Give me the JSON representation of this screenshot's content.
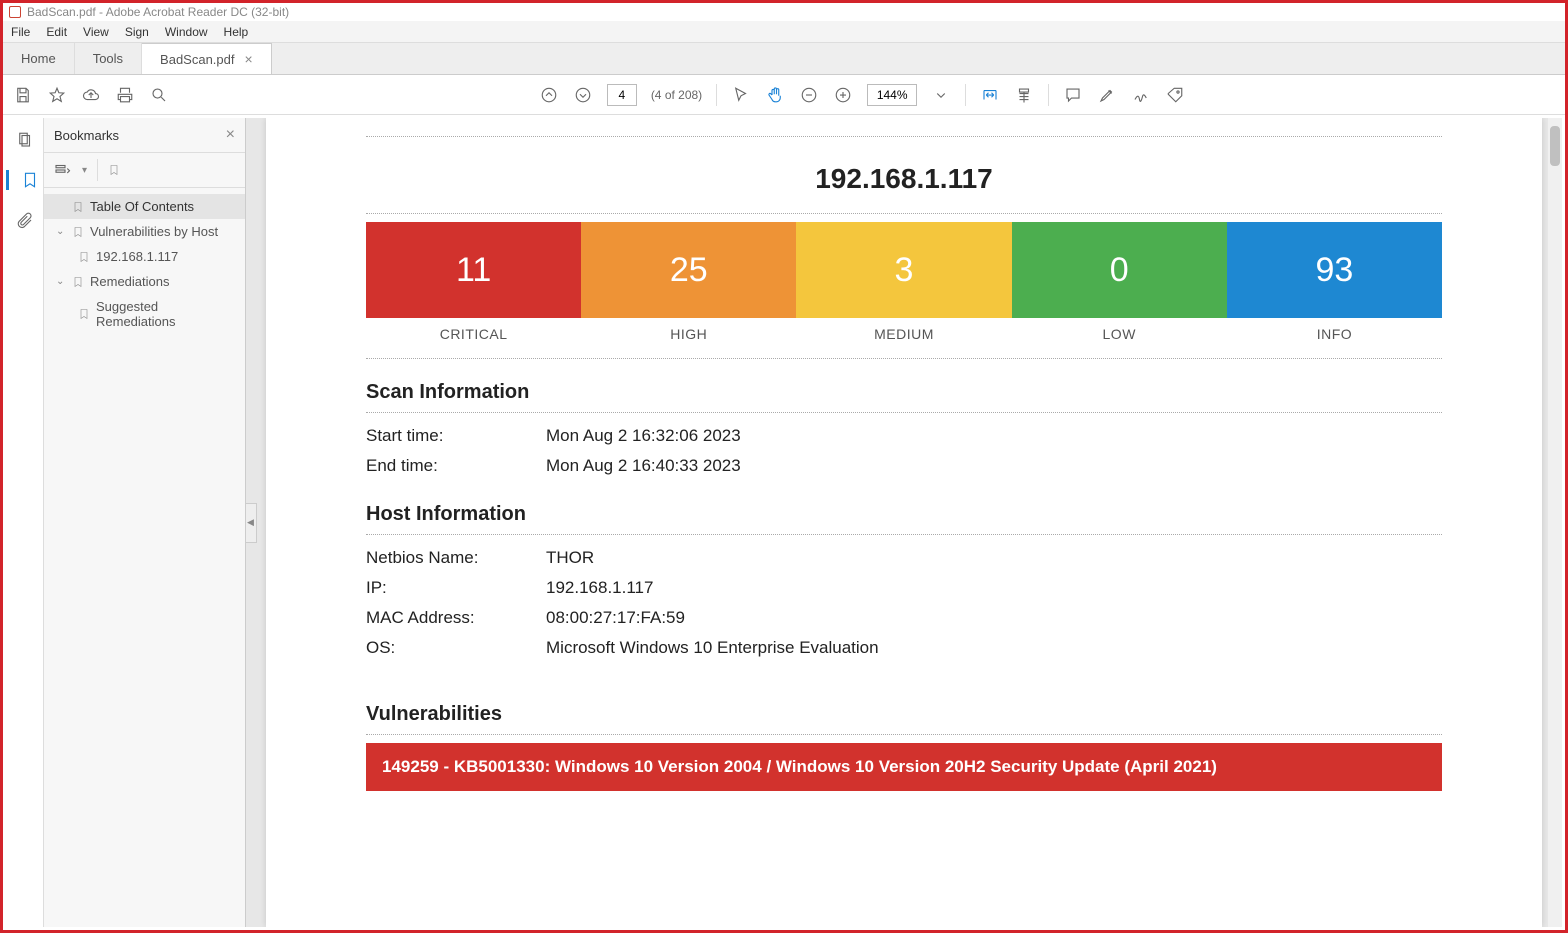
{
  "window": {
    "title": "BadScan.pdf - Adobe Acrobat Reader DC (32-bit)"
  },
  "menubar": [
    "File",
    "Edit",
    "View",
    "Sign",
    "Window",
    "Help"
  ],
  "tabs": {
    "home": "Home",
    "tools": "Tools",
    "doc": "BadScan.pdf"
  },
  "toolbar": {
    "page_current": "4",
    "page_of": "(4 of 208)",
    "zoom": "144%"
  },
  "bookmarks": {
    "title": "Bookmarks",
    "items": [
      {
        "label": "Table Of Contents"
      },
      {
        "label": "Vulnerabilities by Host"
      },
      {
        "label": "192.168.1.117"
      },
      {
        "label": "Remediations"
      },
      {
        "label": "Suggested Remediations"
      }
    ]
  },
  "report": {
    "ip": "192.168.1.117",
    "severity": {
      "critical": {
        "count": "11",
        "label": "CRITICAL",
        "color": "#d2322d"
      },
      "high": {
        "count": "25",
        "label": "HIGH",
        "color": "#ee9336"
      },
      "medium": {
        "count": "3",
        "label": "MEDIUM",
        "color": "#f4c63d"
      },
      "low": {
        "count": "0",
        "label": "LOW",
        "color": "#4cae4f"
      },
      "info": {
        "count": "93",
        "label": "INFO",
        "color": "#1e88d2"
      }
    },
    "scan_info": {
      "heading": "Scan Information",
      "start_label": "Start time:",
      "start_value": "Mon Aug 2 16:32:06 2023",
      "end_label": "End time:",
      "end_value": "Mon Aug 2 16:40:33 2023"
    },
    "host_info": {
      "heading": "Host Information",
      "netbios_label": "Netbios Name:",
      "netbios_value": "THOR",
      "ip_label": "IP:",
      "ip_value": "192.168.1.117",
      "mac_label": "MAC Address:",
      "mac_value": "08:00:27:17:FA:59",
      "os_label": "OS:",
      "os_value": "Microsoft Windows 10 Enterprise Evaluation"
    },
    "vulns": {
      "heading": "Vulnerabilities",
      "first": "149259 - KB5001330: Windows 10 Version 2004 / Windows 10 Version 20H2 Security Update (April 2021)"
    }
  },
  "chart_data": {
    "type": "bar",
    "categories": [
      "CRITICAL",
      "HIGH",
      "MEDIUM",
      "LOW",
      "INFO"
    ],
    "values": [
      11,
      25,
      3,
      0,
      93
    ],
    "colors": [
      "#d2322d",
      "#ee9336",
      "#f4c63d",
      "#4cae4f",
      "#1e88d2"
    ],
    "title": "192.168.1.117",
    "xlabel": "",
    "ylabel": ""
  }
}
